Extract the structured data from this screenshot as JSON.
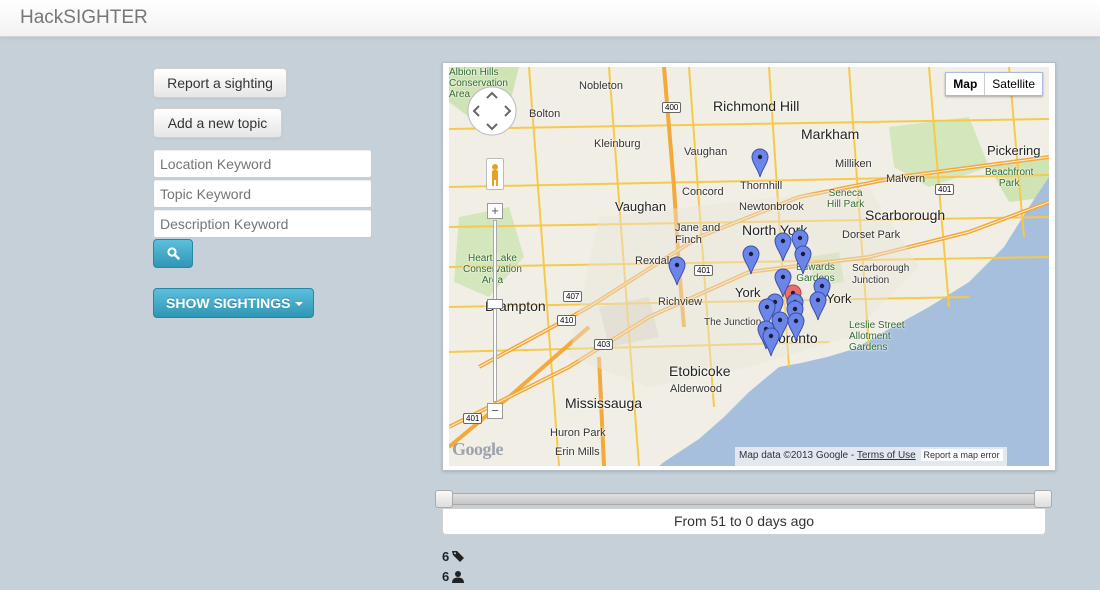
{
  "app": {
    "title": "HackSIGHTER"
  },
  "sidebar": {
    "report_label": "Report a sighting",
    "topic_label": "Add a new topic",
    "location_placeholder": "Location Keyword",
    "topic_placeholder": "Topic Keyword",
    "description_placeholder": "Description Keyword",
    "search_icon": "search-icon",
    "show_label": "SHOW SIGHTINGS"
  },
  "map": {
    "type_options": [
      "Map",
      "Satellite"
    ],
    "selected_type": "Map",
    "logo": "Google",
    "attribution": "Map data ©2013 Google -",
    "terms": "Terms of Use",
    "report_error": "Report a map error",
    "labels": {
      "albion_hills": "Albion Hills\nConservation\nArea",
      "nobleton": "Nobleton",
      "bolton": "Bolton",
      "richmond_hill": "Richmond Hill",
      "markham": "Markham",
      "kleinburg": "Kleinburg",
      "vaughan1": "Vaughan",
      "milliken": "Milliken",
      "pickering": "Pickering",
      "thornhill": "Thornhill",
      "concord": "Concord",
      "malvern": "Malvern",
      "beachfront": "Beachfront\nPark",
      "seneca": "Seneca\nHill Park",
      "vaughan2": "Vaughan",
      "newtonbrook": "Newtonbrook",
      "scarborough": "Scarborough",
      "jane_finch": "Jane and\nFinch",
      "north_york": "North York",
      "dorset": "Dorset Park",
      "heart_lake": "Heart Lake\nConservation\nArea",
      "rexdale": "Rexdale",
      "edwards": "Edwards\nGardens",
      "scarb_junction": "Scarborough\nJunction",
      "york": "York",
      "east_york": "York",
      "brampton": "Brampton",
      "richview": "Richview",
      "junction": "The Junction",
      "toronto": "Toronto",
      "leslie": "Leslie Street\nAllotment\nGardens",
      "etobicoke": "Etobicoke",
      "alderwood": "Alderwood",
      "mississauga": "Mississauga",
      "huron": "Huron Park",
      "erin": "Erin Mills"
    },
    "highways": [
      "400",
      "407",
      "410",
      "403",
      "401",
      "401",
      "401"
    ]
  },
  "slider": {
    "range_text": "From 51 to 0 days ago"
  },
  "stats": {
    "topics_count": "6",
    "topics_icon": "tags-icon",
    "users_count": "6",
    "users_icon": "user-icon"
  },
  "colors": {
    "accent": "#2f96b4",
    "background": "#c5d0d9",
    "marker": "#6b86e8",
    "marker_selected": "#ec6b6b"
  }
}
